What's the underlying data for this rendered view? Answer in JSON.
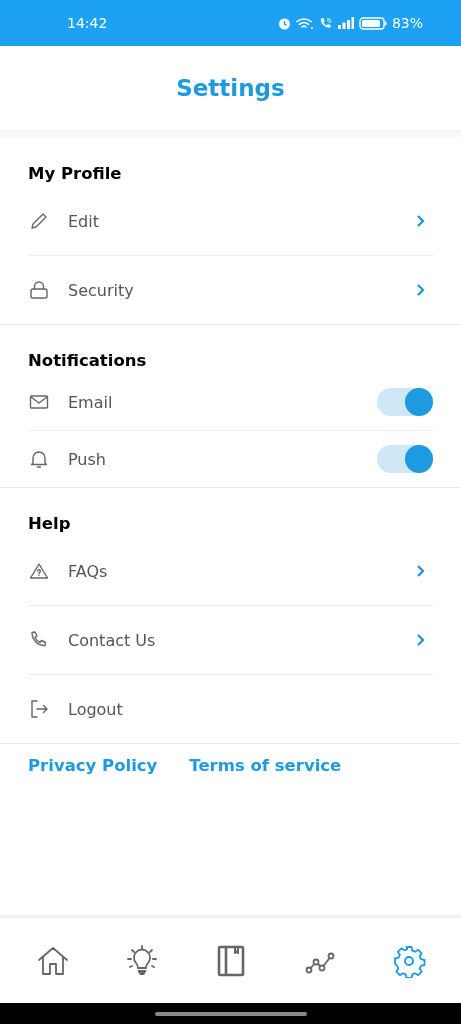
{
  "status_bar": {
    "time": "14:42",
    "battery": "83%"
  },
  "header": {
    "title": "Settings"
  },
  "sections": [
    {
      "title": "My Profile",
      "items": [
        {
          "kind": "link",
          "label": "Edit"
        },
        {
          "kind": "link",
          "label": "Security"
        }
      ]
    },
    {
      "title": "Notifications",
      "items": [
        {
          "kind": "toggle",
          "label": "Email",
          "on": true
        },
        {
          "kind": "toggle",
          "label": "Push",
          "on": true
        }
      ]
    },
    {
      "title": "Help",
      "items": [
        {
          "kind": "link",
          "label": "FAQs"
        },
        {
          "kind": "link",
          "label": "Contact Us"
        },
        {
          "kind": "action",
          "label": "Logout"
        }
      ]
    }
  ],
  "footer_links": [
    "Privacy Policy",
    "Terms of service"
  ],
  "bottom_nav": [
    {
      "selected": false
    },
    {
      "selected": false
    },
    {
      "selected": false
    },
    {
      "selected": false
    },
    {
      "selected": true
    }
  ]
}
